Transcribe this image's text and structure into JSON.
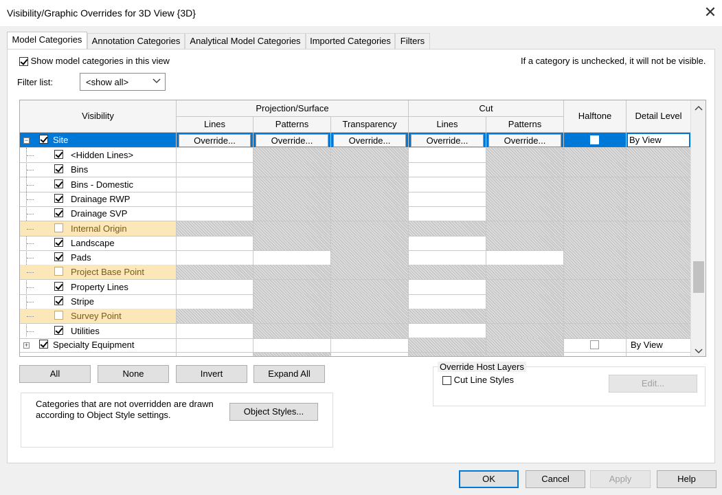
{
  "window": {
    "title": "Visibility/Graphic Overrides for 3D View {3D}",
    "close_glyph": "✕"
  },
  "tabs": [
    {
      "label": "Model Categories",
      "active": true
    },
    {
      "label": "Annotation Categories",
      "active": false
    },
    {
      "label": "Analytical Model Categories",
      "active": false
    },
    {
      "label": "Imported Categories",
      "active": false
    },
    {
      "label": "Filters",
      "active": false
    }
  ],
  "options": {
    "show_model_categories_label": "Show model categories in this view",
    "show_model_categories_checked": true,
    "hint": "If a category is unchecked, it will not be visible.",
    "filter_list_label": "Filter list:",
    "filter_list_value": "<show all>"
  },
  "grid": {
    "headers": {
      "visibility": "Visibility",
      "projection_surface": "Projection/Surface",
      "cut": "Cut",
      "halftone": "Halftone",
      "detail_level": "Detail Level",
      "lines": "Lines",
      "patterns": "Patterns",
      "transparency": "Transparency",
      "cut_lines": "Lines",
      "cut_patterns": "Patterns"
    },
    "override_label": "Override...",
    "rows": [
      {
        "label": "Site",
        "checked": true,
        "selected": true,
        "detail": "By View"
      },
      {
        "label": "<Hidden Lines>",
        "checked": true
      },
      {
        "label": "Bins",
        "checked": true
      },
      {
        "label": "Bins - Domestic",
        "checked": true
      },
      {
        "label": "Drainage RWP",
        "checked": true
      },
      {
        "label": "Drainage SVP",
        "checked": true
      },
      {
        "label": "Internal Origin",
        "checked": false
      },
      {
        "label": "Landscape",
        "checked": true
      },
      {
        "label": "Pads",
        "checked": true
      },
      {
        "label": "Project Base Point",
        "checked": false
      },
      {
        "label": "Property Lines",
        "checked": true
      },
      {
        "label": "Stripe",
        "checked": true
      },
      {
        "label": "Survey Point",
        "checked": false
      },
      {
        "label": "Utilities",
        "checked": true
      },
      {
        "label": "Specialty Equipment",
        "checked": true,
        "detail": "By View"
      }
    ]
  },
  "buttons": {
    "all": "All",
    "none": "None",
    "invert": "Invert",
    "expand_all": "Expand All",
    "object_styles": "Object Styles...",
    "edit": "Edit...",
    "ok": "OK",
    "cancel": "Cancel",
    "apply": "Apply",
    "help": "Help"
  },
  "info_text": "Categories that are not overridden are drawn according to Object Style settings.",
  "override_host_layers": {
    "title": "Override Host Layers",
    "cut_line_styles_label": "Cut Line Styles",
    "cut_line_styles_checked": false
  },
  "colors": {
    "selection": "#0078d7",
    "unchecked_row": "#fce7b8",
    "hatch": "#c7c7c7"
  }
}
